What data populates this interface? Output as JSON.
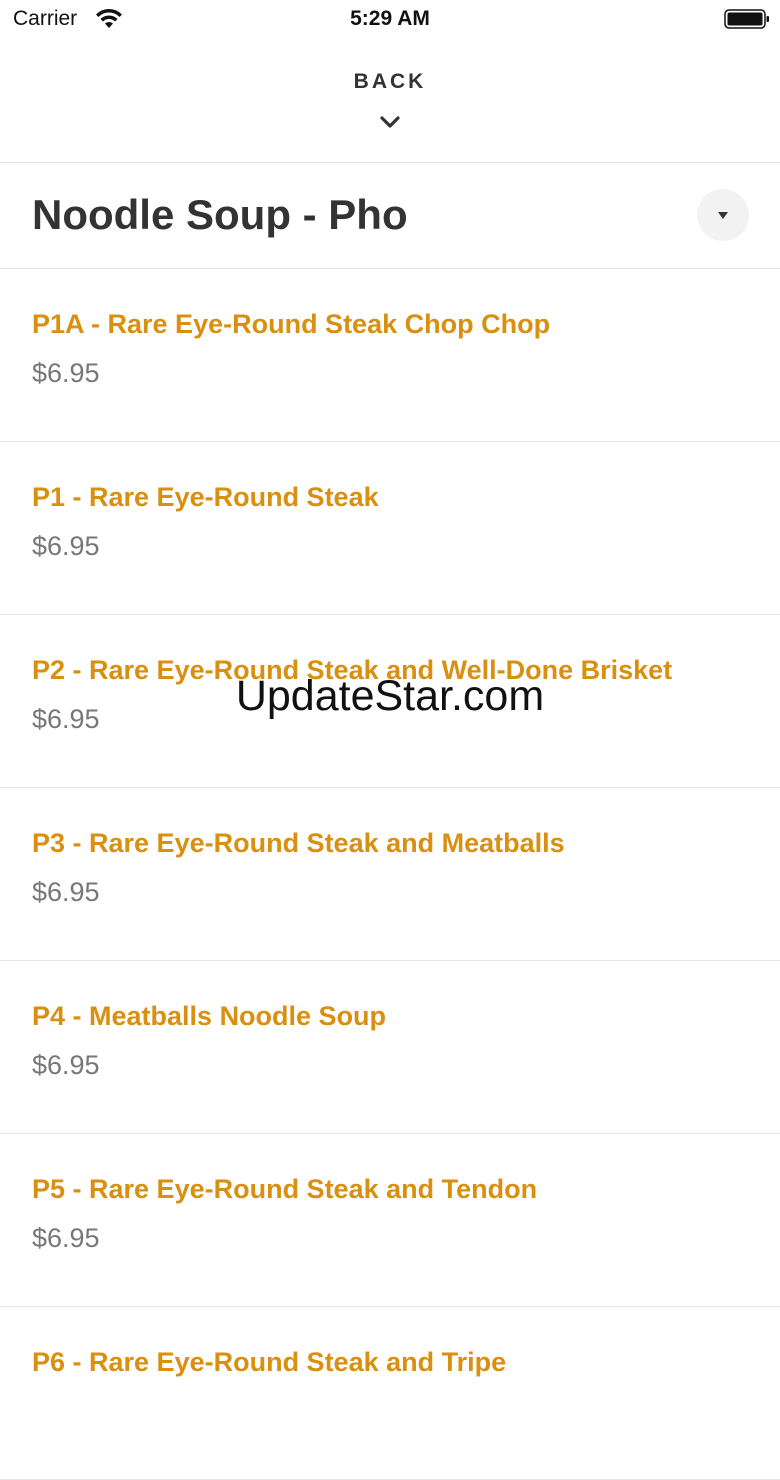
{
  "status_bar": {
    "carrier": "Carrier",
    "time": "5:29 AM"
  },
  "nav": {
    "back_label": "BACK"
  },
  "category": {
    "title": "Noodle Soup - Pho"
  },
  "menu_items": [
    {
      "name": "P1A - Rare Eye-Round Steak Chop Chop",
      "price": "$6.95"
    },
    {
      "name": "P1 - Rare Eye-Round Steak",
      "price": "$6.95"
    },
    {
      "name": "P2 - Rare Eye-Round Steak and Well-Done Brisket",
      "price": "$6.95"
    },
    {
      "name": "P3 - Rare Eye-Round Steak and Meatballs",
      "price": "$6.95"
    },
    {
      "name": "P4 - Meatballs Noodle Soup",
      "price": "$6.95"
    },
    {
      "name": "P5 - Rare Eye-Round Steak and Tendon",
      "price": "$6.95"
    },
    {
      "name": "P6 - Rare Eye-Round Steak and Tripe",
      "price": ""
    }
  ],
  "watermark": "UpdateStar.com",
  "colors": {
    "item_name": "#d98f0f",
    "price": "#777777",
    "title": "#333333"
  },
  "icons": {
    "wifi": "wifi-icon",
    "battery": "battery-icon",
    "back_chevron": "chevron-down-icon",
    "dropdown": "caret-down-icon"
  }
}
